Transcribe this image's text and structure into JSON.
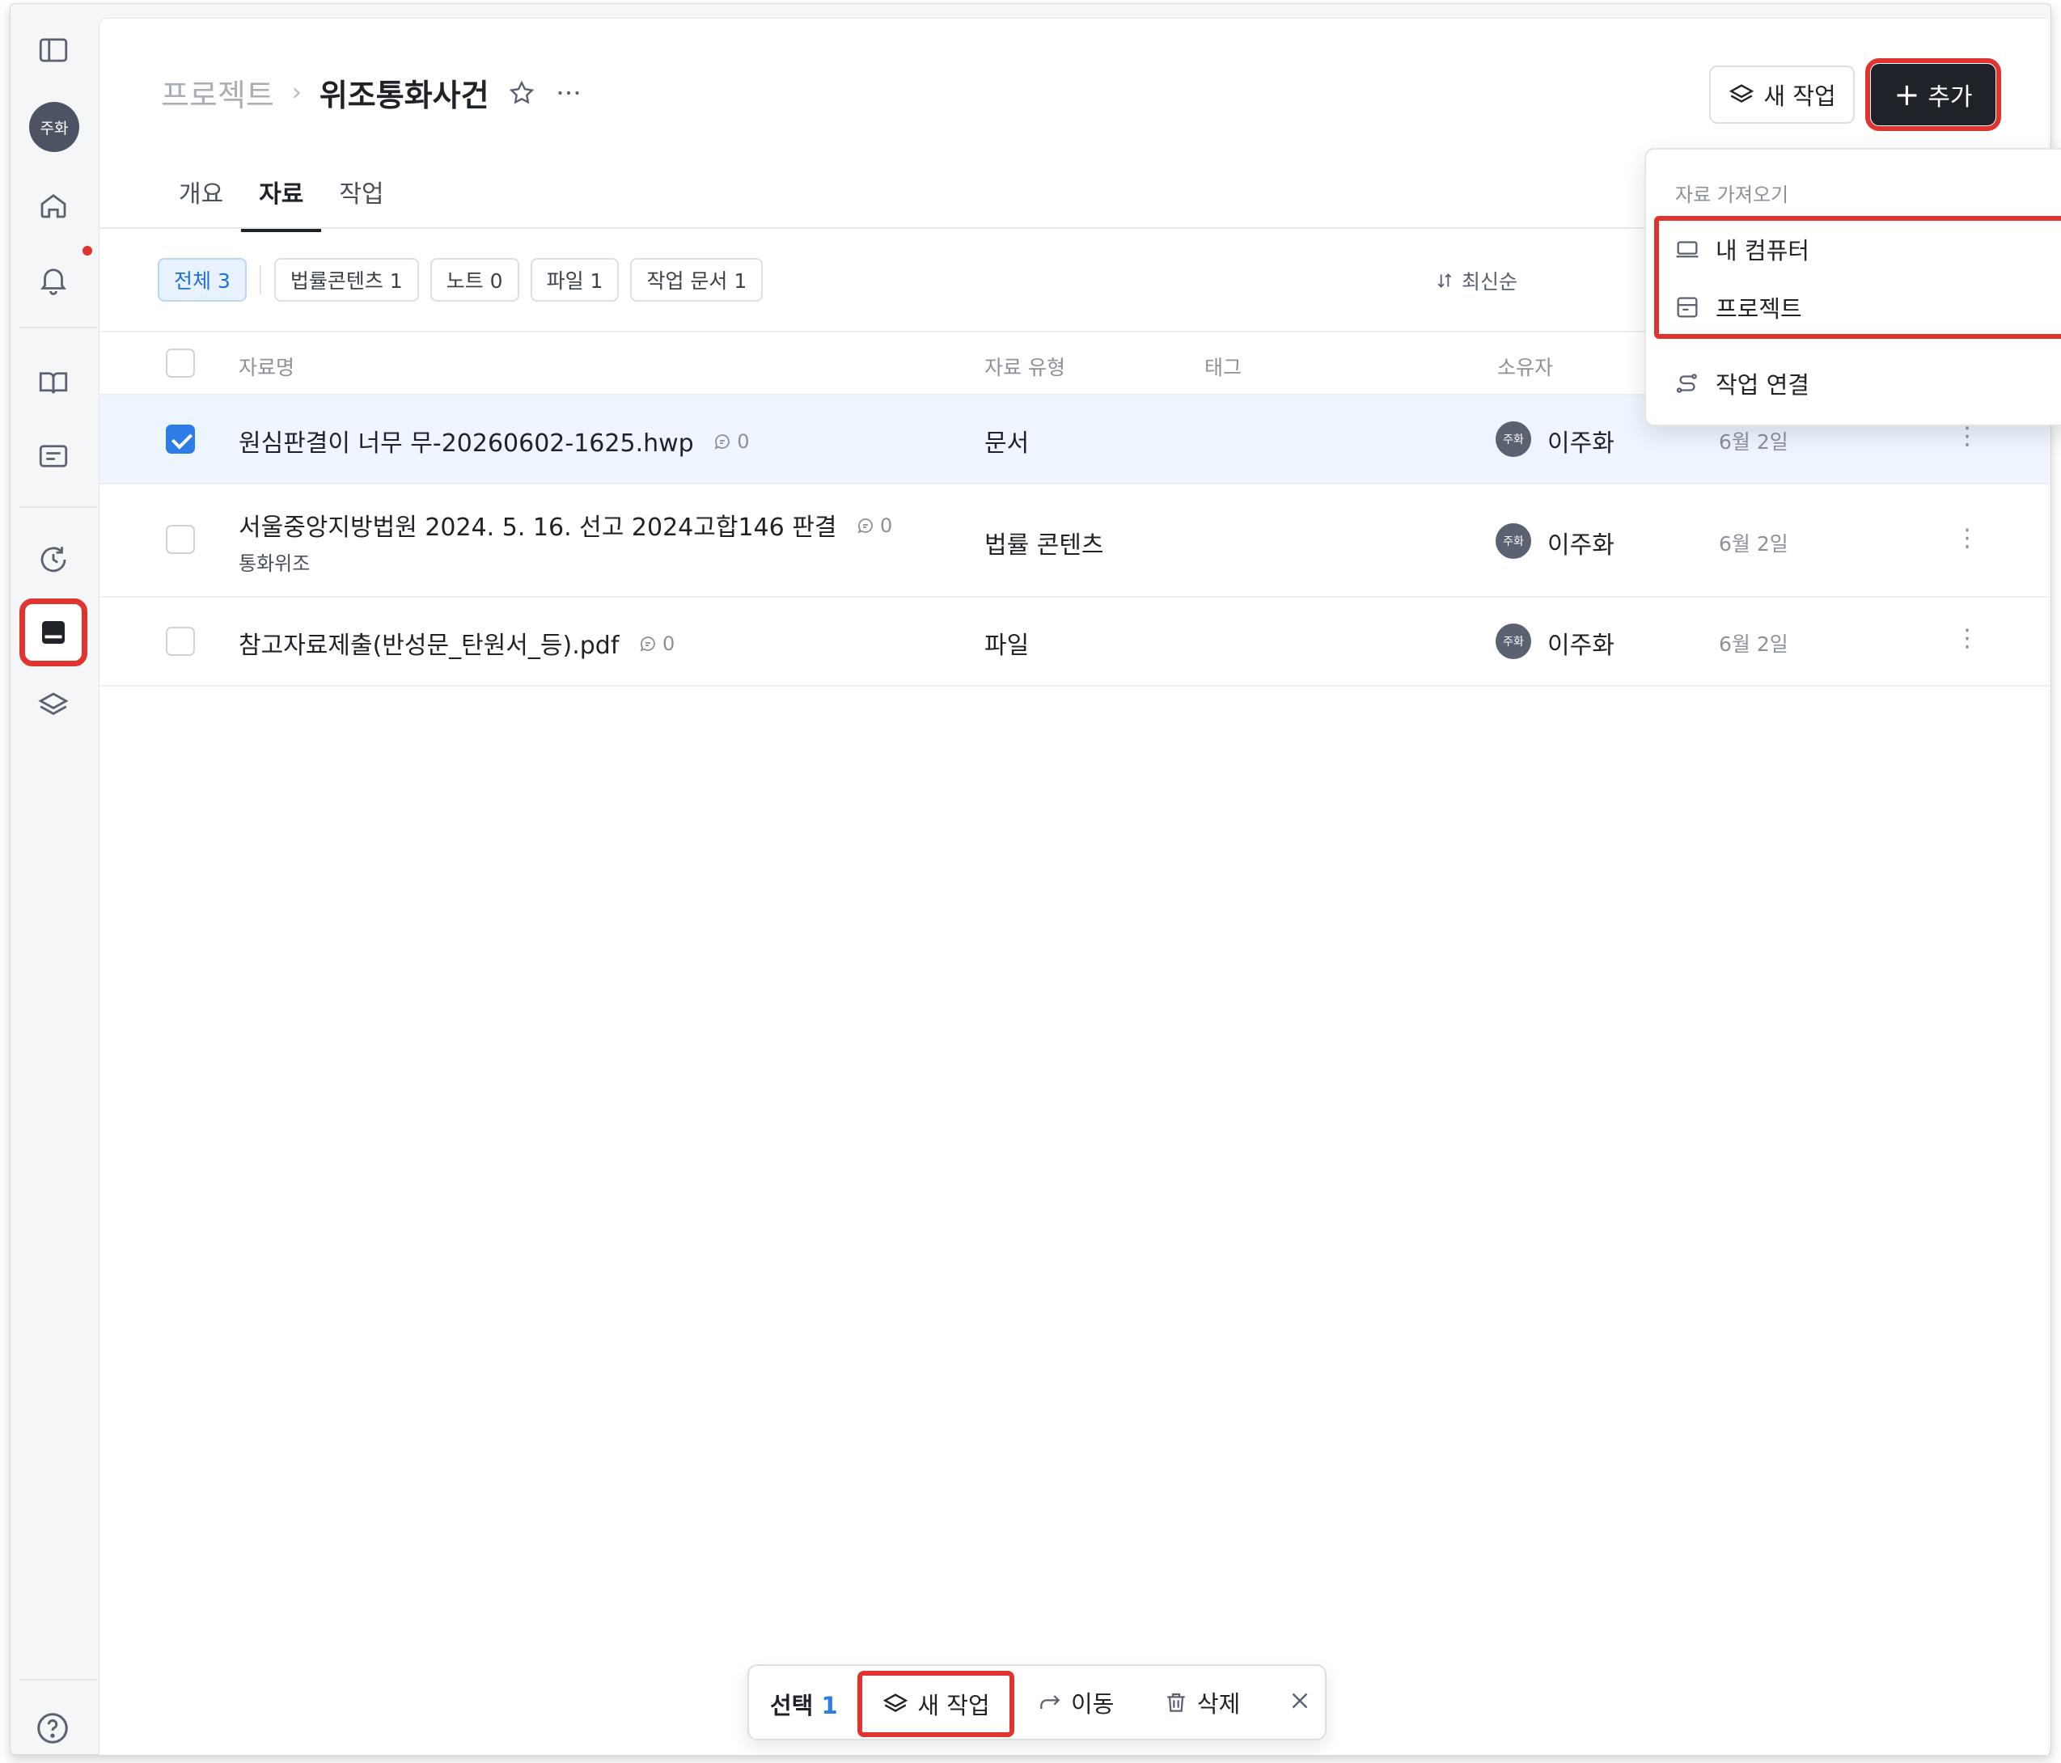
{
  "sidebar": {
    "avatar": "주화",
    "items": [
      "panel-icon",
      "home-icon",
      "bell-icon",
      "book-icon",
      "list-icon",
      "history-icon",
      "inbox-icon",
      "layers-icon",
      "help-icon"
    ]
  },
  "breadcrumb": {
    "parent": "프로젝트",
    "separator": "›",
    "title": "위조통화사건"
  },
  "header": {
    "new_task_label": "새 작업",
    "add_label": "추가"
  },
  "tabs": [
    {
      "label": "개요"
    },
    {
      "label": "자료"
    },
    {
      "label": "작업"
    }
  ],
  "filters": [
    {
      "label": "전체 3"
    },
    {
      "label": "법률콘텐츠 1"
    },
    {
      "label": "노트 0"
    },
    {
      "label": "파일 1"
    },
    {
      "label": "작업 문서 1"
    }
  ],
  "sort_label": "최신순",
  "table": {
    "columns": [
      "자료명",
      "자료 유형",
      "태그",
      "소유자"
    ],
    "rows": [
      {
        "name": "원심판결이 너무 무-20260602-1625.hwp",
        "sub": "",
        "comments": "0",
        "type": "문서",
        "avatar": "주화",
        "owner": "이주화",
        "date": "6월 2일"
      },
      {
        "name": "서울중앙지방법원 2024. 5. 16. 선고 2024고합146 판결",
        "sub": "통화위조",
        "comments": "0",
        "type": "법률 콘텐츠",
        "avatar": "주화",
        "owner": "이주화",
        "date": "6월 2일"
      },
      {
        "name": "참고자료제출(반성문_탄원서_등).pdf",
        "sub": "",
        "comments": "0",
        "type": "파일",
        "avatar": "주화",
        "owner": "이주화",
        "date": "6월 2일"
      }
    ]
  },
  "dropdown": {
    "heading": "자료 가져오기",
    "items": [
      {
        "label": "내 컴퓨터",
        "icon": "laptop-icon"
      },
      {
        "label": "프로젝트",
        "icon": "folder-icon"
      },
      {
        "label": "작업 연결",
        "icon": "link-task-icon"
      }
    ]
  },
  "bottom_bar": {
    "selected_label": "선택",
    "selected_count": "1",
    "new_task_label": "새 작업",
    "move_label": "이동",
    "delete_label": "삭제"
  },
  "colors": {
    "accent": "#2c7de8",
    "highlight": "#e03430",
    "primary_button": "#1f2329"
  }
}
